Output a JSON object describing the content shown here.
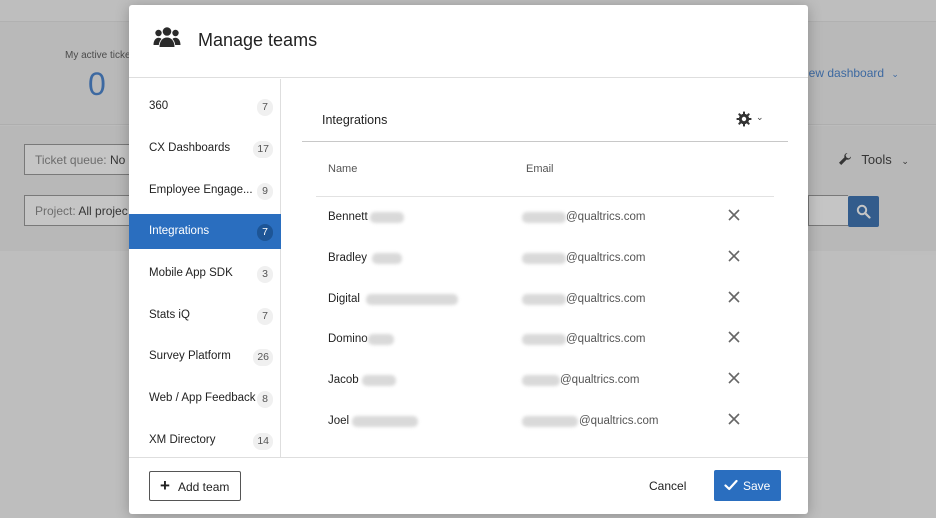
{
  "background": {
    "active_tickets_label": "My active ticket",
    "active_tickets_value": "0",
    "view_dashboard_label": "iew dashboard",
    "ticket_queue": {
      "label": "Ticket queue:",
      "value": "No"
    },
    "project": {
      "label": "Project:",
      "value": "All projec"
    },
    "tools_label": "Tools"
  },
  "modal": {
    "title": "Manage teams",
    "teams": [
      {
        "name": "360",
        "count": "7"
      },
      {
        "name": "CX Dashboards",
        "count": "17"
      },
      {
        "name": "Employee Engage...",
        "count": "9"
      },
      {
        "name": "Integrations",
        "count": "7",
        "active": true
      },
      {
        "name": "Mobile App SDK",
        "count": "3"
      },
      {
        "name": "Stats iQ",
        "count": "7"
      },
      {
        "name": "Survey Platform",
        "count": "26"
      },
      {
        "name": "Web / App Feedback",
        "count": "8"
      },
      {
        "name": "XM Directory",
        "count": "14"
      }
    ],
    "selected_team": "Integrations",
    "columns": {
      "name": "Name",
      "email": "Email"
    },
    "members": [
      {
        "first": "Bennett",
        "email_domain": "@qualtrics.com"
      },
      {
        "first": "Bradley",
        "email_domain": "@qualtrics.com"
      },
      {
        "first": "Digital",
        "email_domain": "@qualtrics.com"
      },
      {
        "first": "Domino",
        "email_domain": "@qualtrics.com"
      },
      {
        "first": "Jacob",
        "email_domain": "@qualtrics.com"
      },
      {
        "first": "Joel",
        "email_domain": "@qualtrics.com"
      }
    ],
    "footer": {
      "add_team_label": "Add team",
      "cancel_label": "Cancel",
      "save_label": "Save"
    }
  },
  "colors": {
    "accent": "#2a6ebf",
    "accent_dark": "#1d5596",
    "brand_blue": "#2e72c8"
  },
  "icons": {
    "header": "team-icon",
    "settings": "gear-icon",
    "remove": "close-icon",
    "add": "plus-icon",
    "save": "check-icon",
    "search": "search-icon",
    "tools": "wrench-icon"
  }
}
